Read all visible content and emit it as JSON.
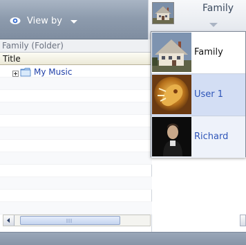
{
  "topbar": {
    "view_by_label": "View by",
    "user_tab": {
      "name": "Family"
    }
  },
  "pane": {
    "header": "Family (Folder)",
    "column_title": "Title",
    "tree": [
      {
        "label": "My Music",
        "icon": "folder-icon",
        "expanded": false
      }
    ]
  },
  "dropdown": {
    "items": [
      {
        "label": "Family",
        "thumbnail": "house-icon",
        "state": "normal"
      },
      {
        "label": "User 1",
        "thumbnail": "lion-emblem-icon",
        "state": "selected"
      },
      {
        "label": "Richard",
        "thumbnail": "person-photo-icon",
        "state": "hover"
      }
    ]
  },
  "colors": {
    "topbar": "#8e9cae",
    "link_blue": "#1f3fa8",
    "selected_bg": "#d3def4",
    "selected_text": "#2e55b8"
  }
}
